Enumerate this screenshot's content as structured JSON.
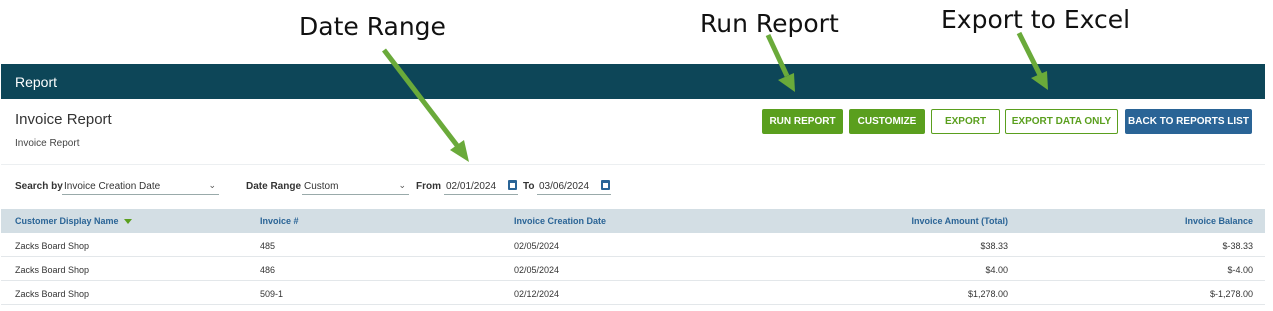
{
  "callouts": {
    "date_range": "Date Range",
    "run_report": "Run Report",
    "export_excel": "Export to Excel"
  },
  "colors": {
    "header_bg": "#0d4658",
    "accent_green": "#5a9f1e",
    "primary_blue": "#2a6496",
    "table_header_bg": "#d3dee4",
    "arrow_green": "#6aaa3a"
  },
  "header": {
    "title": "Report"
  },
  "report": {
    "title": "Invoice Report",
    "subtitle": "Invoice Report"
  },
  "actions": {
    "run_report": "RUN REPORT",
    "customize": "CUSTOMIZE",
    "export": "EXPORT",
    "export_data_only": "EXPORT DATA ONLY",
    "back": "BACK TO REPORTS LIST"
  },
  "filters": {
    "search_by_label": "Search by",
    "search_by_value": "Invoice Creation Date",
    "date_range_label": "Date Range",
    "date_range_value": "Custom",
    "from_label": "From",
    "from_value": "02/01/2024",
    "to_label": "To",
    "to_value": "03/06/2024"
  },
  "table": {
    "columns": [
      "Customer Display Name",
      "Invoice #",
      "Invoice Creation Date",
      "Invoice Amount (Total)",
      "Invoice Balance"
    ],
    "sort_icon": "sort-desc-icon",
    "rows": [
      [
        "Zacks Board Shop",
        "485",
        "02/05/2024",
        "$38.33",
        "$-38.33"
      ],
      [
        "Zacks Board Shop",
        "486",
        "02/05/2024",
        "$4.00",
        "$-4.00"
      ],
      [
        "Zacks Board Shop",
        "509-1",
        "02/12/2024",
        "$1,278.00",
        "$-1,278.00"
      ]
    ]
  }
}
